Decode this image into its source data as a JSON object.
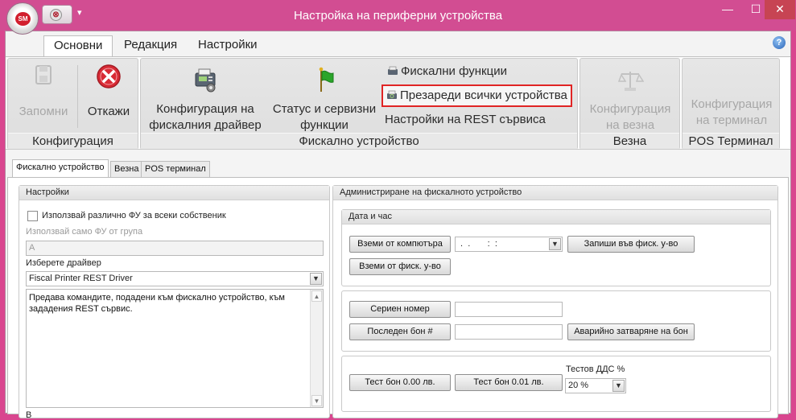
{
  "window": {
    "title": "Настройка на периферни устройства",
    "logo_text": "SM",
    "quick_close": "⊗",
    "quick_dropdown": "▾",
    "minimize": "—",
    "maximize": "☐",
    "close": "✕"
  },
  "ribbon_tabs": [
    "Основни",
    "Редакция",
    "Настройки"
  ],
  "help": "?",
  "ribbon": {
    "config_group": {
      "label": "Конфигурация",
      "save_label": "Запомни",
      "cancel_label": "Откажи"
    },
    "fiscal_group": {
      "label": "Фискално устройство",
      "driver_config_label": [
        "Конфигурация на",
        "фискалния драйвер"
      ],
      "status_label": [
        "Статус и сервизни",
        "функции"
      ],
      "fiscal_functions_label": "Фискални функции",
      "reload_label": "Презареди всички устройства",
      "rest_settings_label": "Настройки на REST сървиса"
    },
    "scale_group": {
      "label": "Везна",
      "config_label": [
        "Конфигурация",
        "на везна"
      ]
    },
    "pos_group": {
      "label": "POS Терминал",
      "config_label": [
        "Конфигурация",
        "на терминал"
      ]
    }
  },
  "doc_tabs": [
    "Фискално устройство",
    "Везна",
    "POS терминал"
  ],
  "settings_panel": {
    "title": "Настройки",
    "use_different_label": "Използвай различно ФУ за всеки собственик",
    "use_group_label": "Използвай само ФУ от група",
    "group_value": "А",
    "driver_label": "Изберете драйвер",
    "driver_value": "Fiscal Printer REST Driver",
    "description_text": "Предава командите, подадени към фискално устройство, към зададения REST сървис.",
    "cut_label": "В"
  },
  "admin_panel": {
    "title": "Администриране на фискалното устройство",
    "datetime": {
      "title": "Дата и час",
      "from_pc_label": "Вземи от компютъра",
      "datetime_value": " .  .       :  :",
      "write_label": "Запиши във фиск. у-во",
      "from_device_label": "Вземи от фиск. у-во"
    },
    "serial_label": "Сериен номер",
    "serial_value": "",
    "last_receipt_label": "Последен бон #",
    "last_receipt_value": "",
    "emergency_label": "Аварийно затваряне на бон",
    "test_000_label": "Тест бон 0.00 лв.",
    "test_001_label": "Тест бон 0.01 лв.",
    "test_vat_label": "Тестов ДДС %",
    "test_vat_value": "20 %"
  },
  "colors": {
    "title_bar": "#d24d92",
    "highlight_border": "#e02424",
    "cancel_icon": "#d82b35"
  }
}
